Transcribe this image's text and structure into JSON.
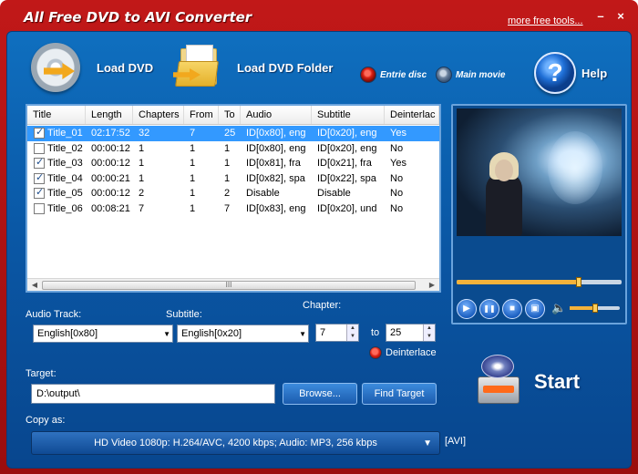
{
  "window": {
    "title": "All Free DVD to AVI Converter",
    "more_tools": "more free tools...",
    "minimize": "–",
    "close": "×"
  },
  "toolbar": {
    "load_dvd": "Load DVD",
    "load_dvd_folder": "Load DVD Folder",
    "entire_disc": "Entrie disc",
    "main_movie": "Main movie",
    "help": "Help",
    "help_glyph": "?",
    "selected_mode": "entire_disc"
  },
  "table": {
    "columns": [
      "Title",
      "Length",
      "Chapters",
      "From",
      "To",
      "Audio",
      "Subtitle",
      "Deinterlac"
    ],
    "rows": [
      {
        "checked": true,
        "title": "Title_01",
        "length": "02:17:52",
        "chapters": "32",
        "from": "7",
        "to": "25",
        "audio": "ID[0x80], eng",
        "subtitle": "ID[0x20], eng",
        "deinterlace": "Yes",
        "selected": true
      },
      {
        "checked": false,
        "title": "Title_02",
        "length": "00:00:12",
        "chapters": "1",
        "from": "1",
        "to": "1",
        "audio": "ID[0x80], eng",
        "subtitle": "ID[0x20], eng",
        "deinterlace": "No",
        "selected": false
      },
      {
        "checked": true,
        "title": "Title_03",
        "length": "00:00:12",
        "chapters": "1",
        "from": "1",
        "to": "1",
        "audio": "ID[0x81], fra",
        "subtitle": "ID[0x21], fra",
        "deinterlace": "Yes",
        "selected": false
      },
      {
        "checked": true,
        "title": "Title_04",
        "length": "00:00:21",
        "chapters": "1",
        "from": "1",
        "to": "1",
        "audio": "ID[0x82], spa",
        "subtitle": "ID[0x22], spa",
        "deinterlace": "No",
        "selected": false
      },
      {
        "checked": true,
        "title": "Title_05",
        "length": "00:00:12",
        "chapters": "2",
        "from": "1",
        "to": "2",
        "audio": "Disable",
        "subtitle": "Disable",
        "deinterlace": "No",
        "selected": false
      },
      {
        "checked": false,
        "title": "Title_06",
        "length": "00:08:21",
        "chapters": "7",
        "from": "1",
        "to": "7",
        "audio": "ID[0x83], eng",
        "subtitle": "ID[0x20], und",
        "deinterlace": "No",
        "selected": false
      }
    ],
    "scroll_left": "◀",
    "scroll_right": "▶",
    "scroll_grip": "III"
  },
  "player": {
    "seek_progress": 0.74,
    "volume_level": 0.5,
    "play": "▶",
    "pause": "❚❚",
    "stop": "■",
    "snapshot": "▣",
    "volume_glyph": "🔈"
  },
  "form": {
    "audio_track_label": "Audio Track:",
    "audio_track_value": "English[0x80]",
    "subtitle_label": "Subtitle:",
    "subtitle_value": "English[0x20]",
    "chapter_label": "Chapter:",
    "chapter_from": "7",
    "chapter_to_label": "to",
    "chapter_to": "25",
    "deinterlace_label": "Deinterlace",
    "deinterlace_on": true,
    "target_label": "Target:",
    "target_value": "D:\\output\\",
    "browse_button": "Browse...",
    "find_target_button": "Find Target",
    "copy_as_label": "Copy as:",
    "copy_as_value": "HD Video 1080p: H.264/AVC, 4200 kbps; Audio: MP3, 256 kbps",
    "format_badge": "[AVI]",
    "dropdown_glyph": "▼",
    "spin_up": "▲",
    "spin_down": "▼"
  },
  "start": {
    "label": "Start"
  },
  "colors": {
    "window_red": "#c11818",
    "panel_blue": "#0a58a6",
    "selection_blue": "#3399ff",
    "accent_orange": "#f4b23a"
  }
}
